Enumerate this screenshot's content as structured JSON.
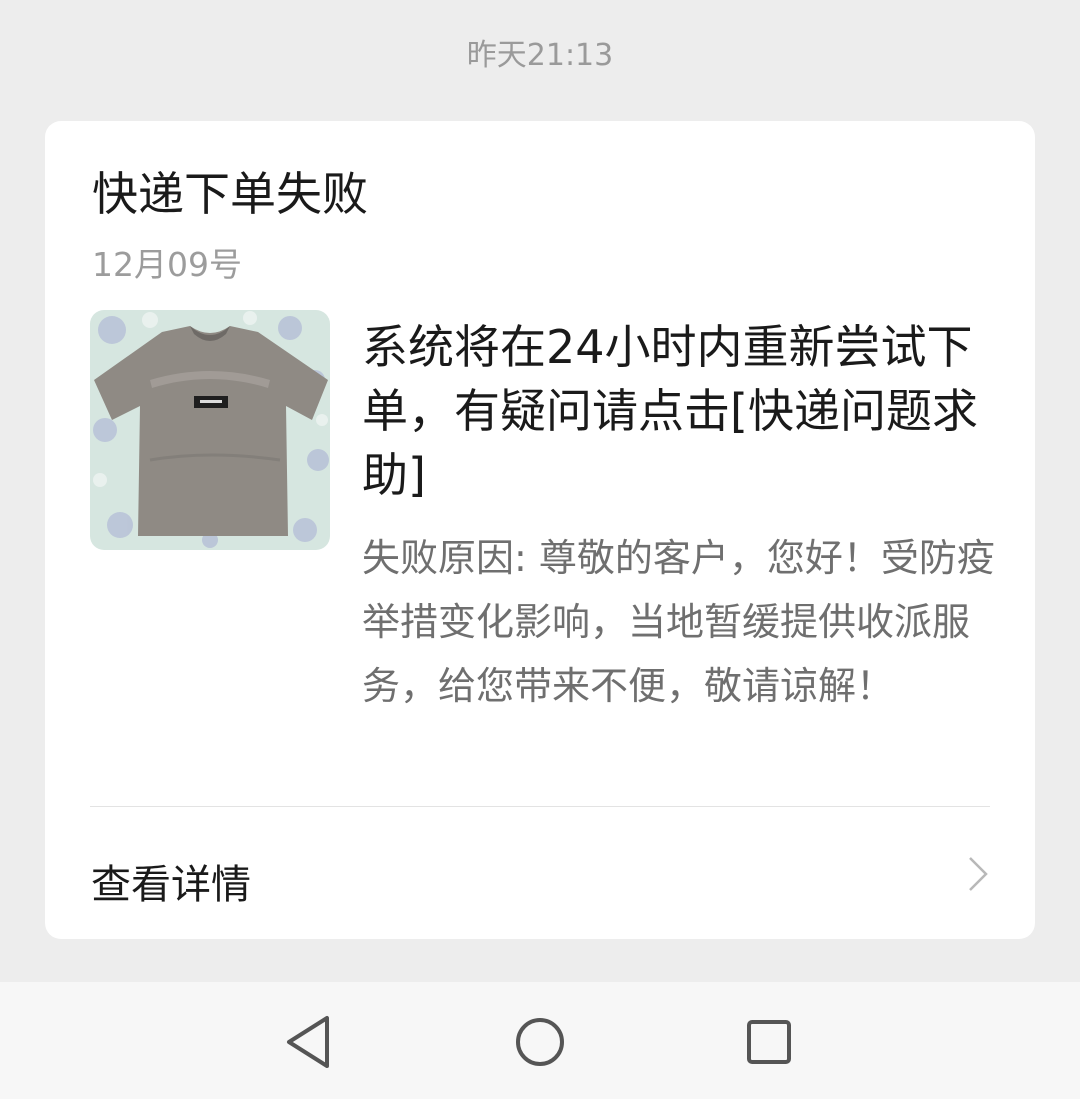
{
  "timestamp": "昨天21:13",
  "card": {
    "title": "快递下单失败",
    "date": "12月09号",
    "thumbnail_icon": "tshirt-product-image",
    "headline": "系统将在24小时内重新尝试下单，有疑问请点击[快递问题求助]",
    "reason": "失败原因: 尊敬的客户，您好！受防疫举措变化影响，当地暂缓提供收派服务，给您带来不便，敬请谅解！",
    "detail_label": "查看详情",
    "detail_icon": "chevron-right-icon"
  },
  "navbar": {
    "back_icon": "back-triangle-icon",
    "home_icon": "home-circle-icon",
    "recent_icon": "recent-square-icon"
  }
}
